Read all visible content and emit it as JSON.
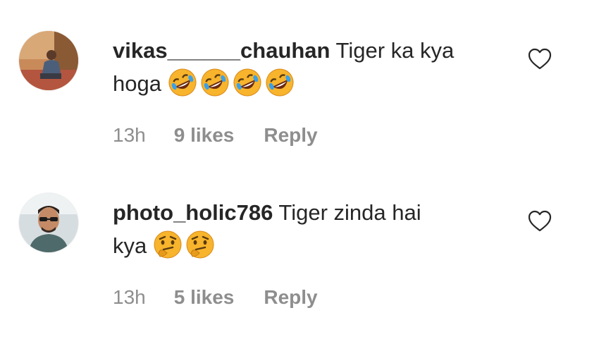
{
  "comments": [
    {
      "username": "vikas______chauhan",
      "text_line1": " Tiger ka kya",
      "text_line2": "hoga ",
      "emojis": [
        "rolling-on-floor-laughing-emoji",
        "rolling-on-floor-laughing-emoji",
        "rolling-on-floor-laughing-emoji",
        "rolling-on-floor-laughing-emoji"
      ],
      "time": "13h",
      "likes": "9 likes",
      "reply": "Reply"
    },
    {
      "username": "photo_holic786",
      "text_line1": " Tiger zinda hai",
      "text_line2": "kya ",
      "emojis": [
        "thinking-face-emoji",
        "thinking-face-emoji"
      ],
      "time": "13h",
      "likes": "5 likes",
      "reply": "Reply"
    }
  ],
  "colors": {
    "text": "#262626",
    "muted": "#8e8e8e",
    "emoji_yellow": "#f7b42c",
    "emoji_tear": "#3aa0e8",
    "heart_stroke": "#262626"
  },
  "icons": {
    "like": "heart-outline-icon"
  }
}
